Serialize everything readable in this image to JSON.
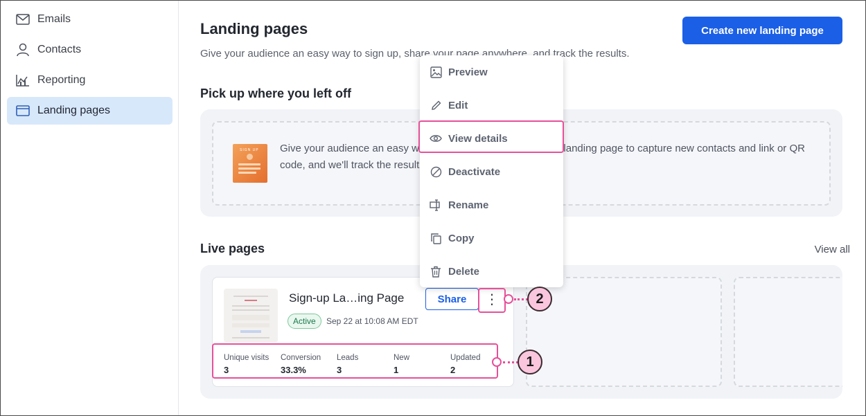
{
  "sidebar": {
    "items": [
      {
        "label": "Emails",
        "icon": "mail-icon",
        "active": false
      },
      {
        "label": "Contacts",
        "icon": "person-icon",
        "active": false
      },
      {
        "label": "Reporting",
        "icon": "chart-icon",
        "active": false
      },
      {
        "label": "Landing pages",
        "icon": "browser-window-icon",
        "active": true
      }
    ]
  },
  "header": {
    "title": "Landing pages",
    "subtitle": "Give your audience an easy way to sign up, share your page anywhere, and track the results.",
    "create_button": "Create new landing page"
  },
  "pickup": {
    "title": "Pick up where you left off",
    "thumb_label": "SIGN UP",
    "text": "Give your audience an easy way to sign up. Create a sign-up landing page to capture new contacts and link or QR code, and we'll track the results."
  },
  "live": {
    "title": "Live pages",
    "view_all": "View all",
    "card": {
      "title": "Sign-up La…ing Page",
      "status": "Active",
      "date": "Sep 22 at 10:08 AM EDT",
      "share_label": "Share",
      "more_label": "⋮",
      "stats": [
        {
          "label": "Unique visits",
          "value": "3"
        },
        {
          "label": "Conversion",
          "value": "33.3%"
        },
        {
          "label": "Leads",
          "value": "3"
        },
        {
          "label": "New",
          "value": "1"
        },
        {
          "label": "Updated",
          "value": "2"
        }
      ]
    }
  },
  "menu": {
    "items": [
      {
        "label": "Preview",
        "icon": "image-icon"
      },
      {
        "label": "Edit",
        "icon": "pencil-icon"
      },
      {
        "label": "View details",
        "icon": "eye-icon"
      },
      {
        "label": "Deactivate",
        "icon": "block-icon"
      },
      {
        "label": "Rename",
        "icon": "rename-icon"
      },
      {
        "label": "Copy",
        "icon": "copy-icon"
      },
      {
        "label": "Delete",
        "icon": "trash-icon"
      }
    ]
  },
  "callouts": [
    {
      "number": "1"
    },
    {
      "number": "2"
    }
  ],
  "colors": {
    "accent": "#1b5fe6",
    "active_nav": "#d8e8fb",
    "highlight": "#e6509a",
    "callout_fill": "#f9c6dd",
    "status_green": "#18794a"
  }
}
